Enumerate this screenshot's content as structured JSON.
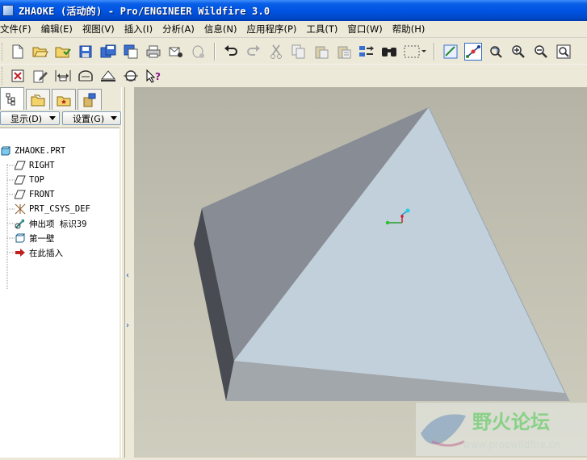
{
  "window": {
    "title": "ZHAOKE (活动的) - Pro/ENGINEER Wildfire 3.0"
  },
  "menubar": {
    "items": [
      "文件(F)",
      "编辑(E)",
      "视图(V)",
      "插入(I)",
      "分析(A)",
      "信息(N)",
      "应用程序(P)",
      "工具(T)",
      "窗口(W)",
      "帮助(H)"
    ]
  },
  "toolbar1": {
    "buttons": [
      "new-icon",
      "open-icon",
      "open-session-icon",
      "save-icon",
      "save-copy-icon",
      "backup-icon",
      "print-icon",
      "email-icon",
      "email-link-icon",
      "undo-icon",
      "redo-icon",
      "cut-icon",
      "copy-icon",
      "paste-icon",
      "paste-special-icon",
      "regenerate-icon",
      "find-icon",
      "select-box-icon",
      "repaint-icon",
      "spin-center-icon",
      "orient-icon",
      "zoom-in-icon",
      "zoom-out-icon",
      "refit-icon"
    ]
  },
  "toolbar2": {
    "buttons": [
      "close-window-icon",
      "edit-icon",
      "dimension-icon",
      "sketch-icon",
      "datum-plane-icon",
      "measure-icon",
      "context-help-icon"
    ]
  },
  "panel": {
    "tabs": [
      "model-tree-tab",
      "folder-browser-tab",
      "favorites-tab",
      "connections-tab"
    ],
    "show_button": "显示(D)",
    "settings_button": "设置(G)",
    "tree": [
      {
        "label": "ZHAOKE.PRT",
        "icon": "part-icon"
      },
      {
        "label": "RIGHT",
        "icon": "datum-plane-icon"
      },
      {
        "label": "TOP",
        "icon": "datum-plane-icon"
      },
      {
        "label": "FRONT",
        "icon": "datum-plane-icon"
      },
      {
        "label": "PRT_CSYS_DEF",
        "icon": "csys-icon"
      },
      {
        "label": "伸出项 标识39",
        "icon": "extrude-icon"
      },
      {
        "label": "第一壁",
        "icon": "wall-icon"
      },
      {
        "label": "在此插入",
        "icon": "insert-here-icon"
      }
    ]
  },
  "watermark": {
    "title": "野火论坛",
    "url": "www.proewildfire.cn"
  },
  "colors": {
    "titlebar": "#0054e3",
    "viewport_bg": "#c2c0b1",
    "accent": "#316ac5"
  }
}
